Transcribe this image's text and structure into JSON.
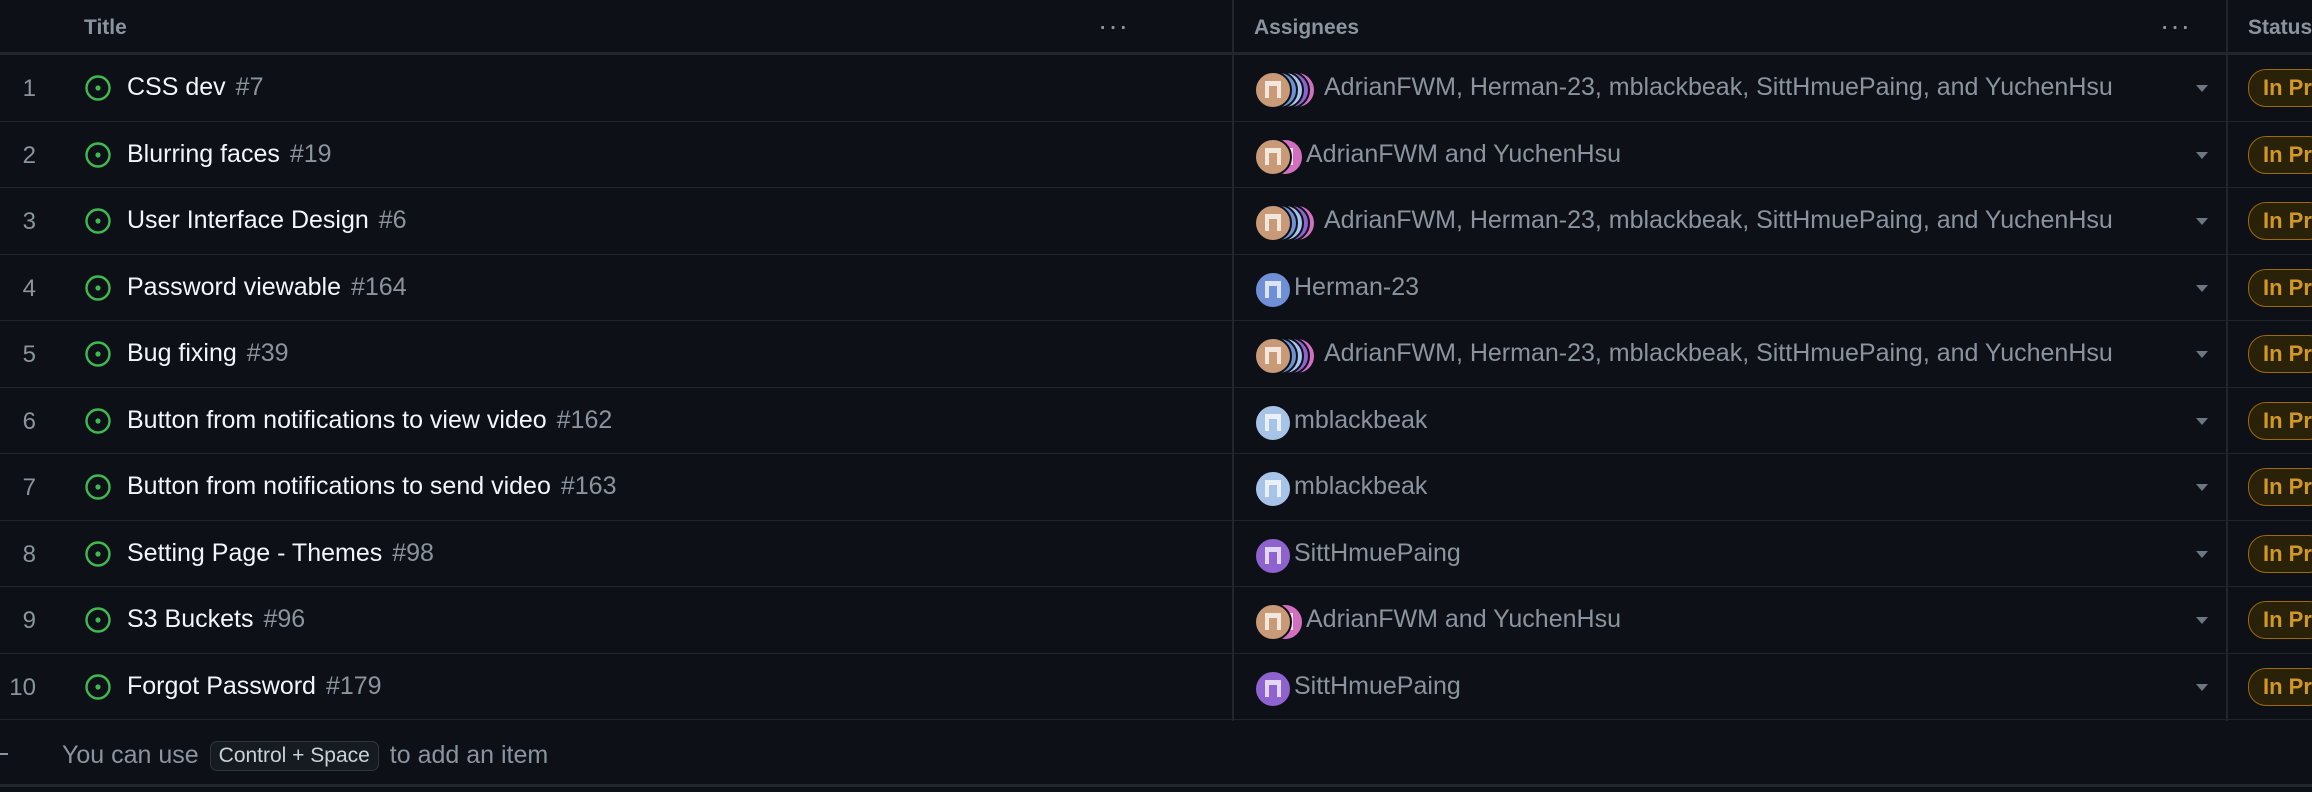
{
  "columns": {
    "title": "Title",
    "assignees": "Assignees",
    "status": "Status"
  },
  "rows": [
    {
      "index": "1",
      "title": "CSS dev",
      "number": "#7",
      "assignees": "AdrianFWM, Herman-23, mblackbeak, SittHmuePaing, and YuchenHsu",
      "avatars": [
        "adrian",
        "herman",
        "mblack",
        "sitt",
        "yuchen"
      ],
      "status": "In Pr"
    },
    {
      "index": "2",
      "title": "Blurring faces",
      "number": "#19",
      "assignees": "AdrianFWM and YuchenHsu",
      "avatars": [
        "adrian",
        "yuchen"
      ],
      "status": "In Pr"
    },
    {
      "index": "3",
      "title": "User Interface Design",
      "number": "#6",
      "assignees": "AdrianFWM, Herman-23, mblackbeak, SittHmuePaing, and YuchenHsu",
      "avatars": [
        "adrian",
        "herman",
        "mblack",
        "sitt",
        "yuchen"
      ],
      "status": "In Pr"
    },
    {
      "index": "4",
      "title": "Password viewable",
      "number": "#164",
      "assignees": "Herman-23",
      "avatars": [
        "herman"
      ],
      "status": "In Pr"
    },
    {
      "index": "5",
      "title": "Bug fixing",
      "number": "#39",
      "assignees": "AdrianFWM, Herman-23, mblackbeak, SittHmuePaing, and YuchenHsu",
      "avatars": [
        "adrian",
        "herman",
        "mblack",
        "sitt",
        "yuchen"
      ],
      "status": "In Pr"
    },
    {
      "index": "6",
      "title": "Button from notifications to view video",
      "number": "#162",
      "assignees": "mblackbeak",
      "avatars": [
        "mblack"
      ],
      "status": "In Pr"
    },
    {
      "index": "7",
      "title": "Button from notifications to send video",
      "number": "#163",
      "assignees": "mblackbeak",
      "avatars": [
        "mblack"
      ],
      "status": "In Pr"
    },
    {
      "index": "8",
      "title": "Setting Page - Themes",
      "number": "#98",
      "assignees": "SittHmuePaing",
      "avatars": [
        "sitt"
      ],
      "status": "In Pr"
    },
    {
      "index": "9",
      "title": "S3 Buckets",
      "number": "#96",
      "assignees": "AdrianFWM and YuchenHsu",
      "avatars": [
        "adrian",
        "yuchen"
      ],
      "status": "In Pr"
    },
    {
      "index": "10",
      "title": "Forgot Password",
      "number": "#179",
      "assignees": "SittHmuePaing",
      "avatars": [
        "sitt"
      ],
      "status": "In Pr"
    }
  ],
  "footer": {
    "prefix": "You can use",
    "shortcut": "Control + Space",
    "suffix": "to add an item"
  },
  "colors": {
    "open_issue": "#3fb950",
    "status_text": "#d29922",
    "status_border": "#9e6a03",
    "adrian": "#c99a78",
    "herman": "#6f8fd6",
    "mblack": "#a7c4e8",
    "sitt": "#8e63cf",
    "yuchen": "#d36fbf"
  },
  "icons": {
    "issue": "issue-opened-icon",
    "menu": "kebab-horizontal-icon",
    "dropdown": "triangle-down-icon"
  }
}
